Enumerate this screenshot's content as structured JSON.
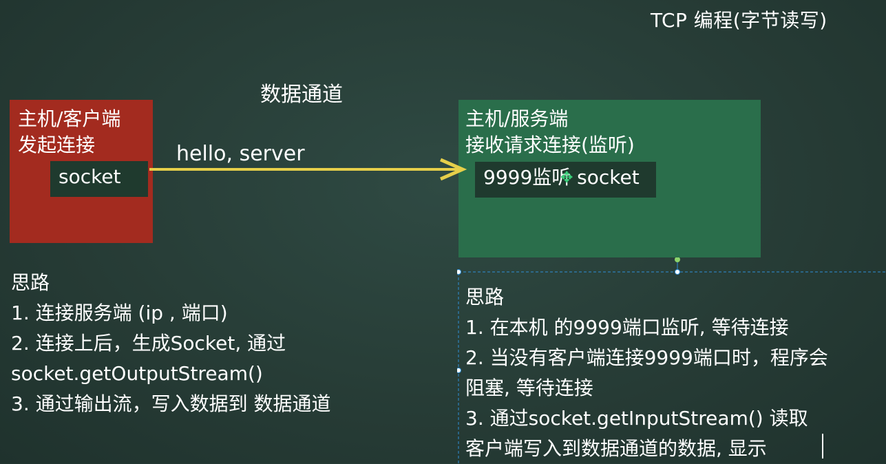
{
  "slide_title": "TCP 编程(字节读写)",
  "channel_label": "数据通道",
  "client": {
    "title": "主机/客户端",
    "subtitle": "发起连接",
    "socket_label": "socket"
  },
  "server": {
    "title": "主机/服务端",
    "subtitle": "接收请求连接(监听)",
    "socket_label": "9999监听 socket"
  },
  "arrow": {
    "message": "hello, server",
    "color": "#e6cf4a"
  },
  "client_notes": {
    "heading": "思路",
    "lines": [
      "1. 连接服务端 (ip , 端口)",
      "2. 连接上后，生成Socket, 通过",
      "socket.getOutputStream()",
      "3. 通过输出流，写入数据到 数据通道"
    ]
  },
  "server_notes": {
    "heading": "思路",
    "lines": [
      "1. 在本机 的9999端口监听, 等待连接",
      "2. 当没有客户端连接9999端口时，程序会",
      "阻塞, 等待连接",
      "3. 通过socket.getInputStream() 读取",
      "客户端写入到数据通道的数据, 显示"
    ]
  },
  "colors": {
    "background": "#28403a",
    "client_box": "#a32b1f",
    "server_box": "#2a6e4b",
    "socket_box": "#1f3a2e",
    "selection": "#2f8fd8"
  },
  "icons": {
    "cursor": "move-cursor-icon"
  }
}
